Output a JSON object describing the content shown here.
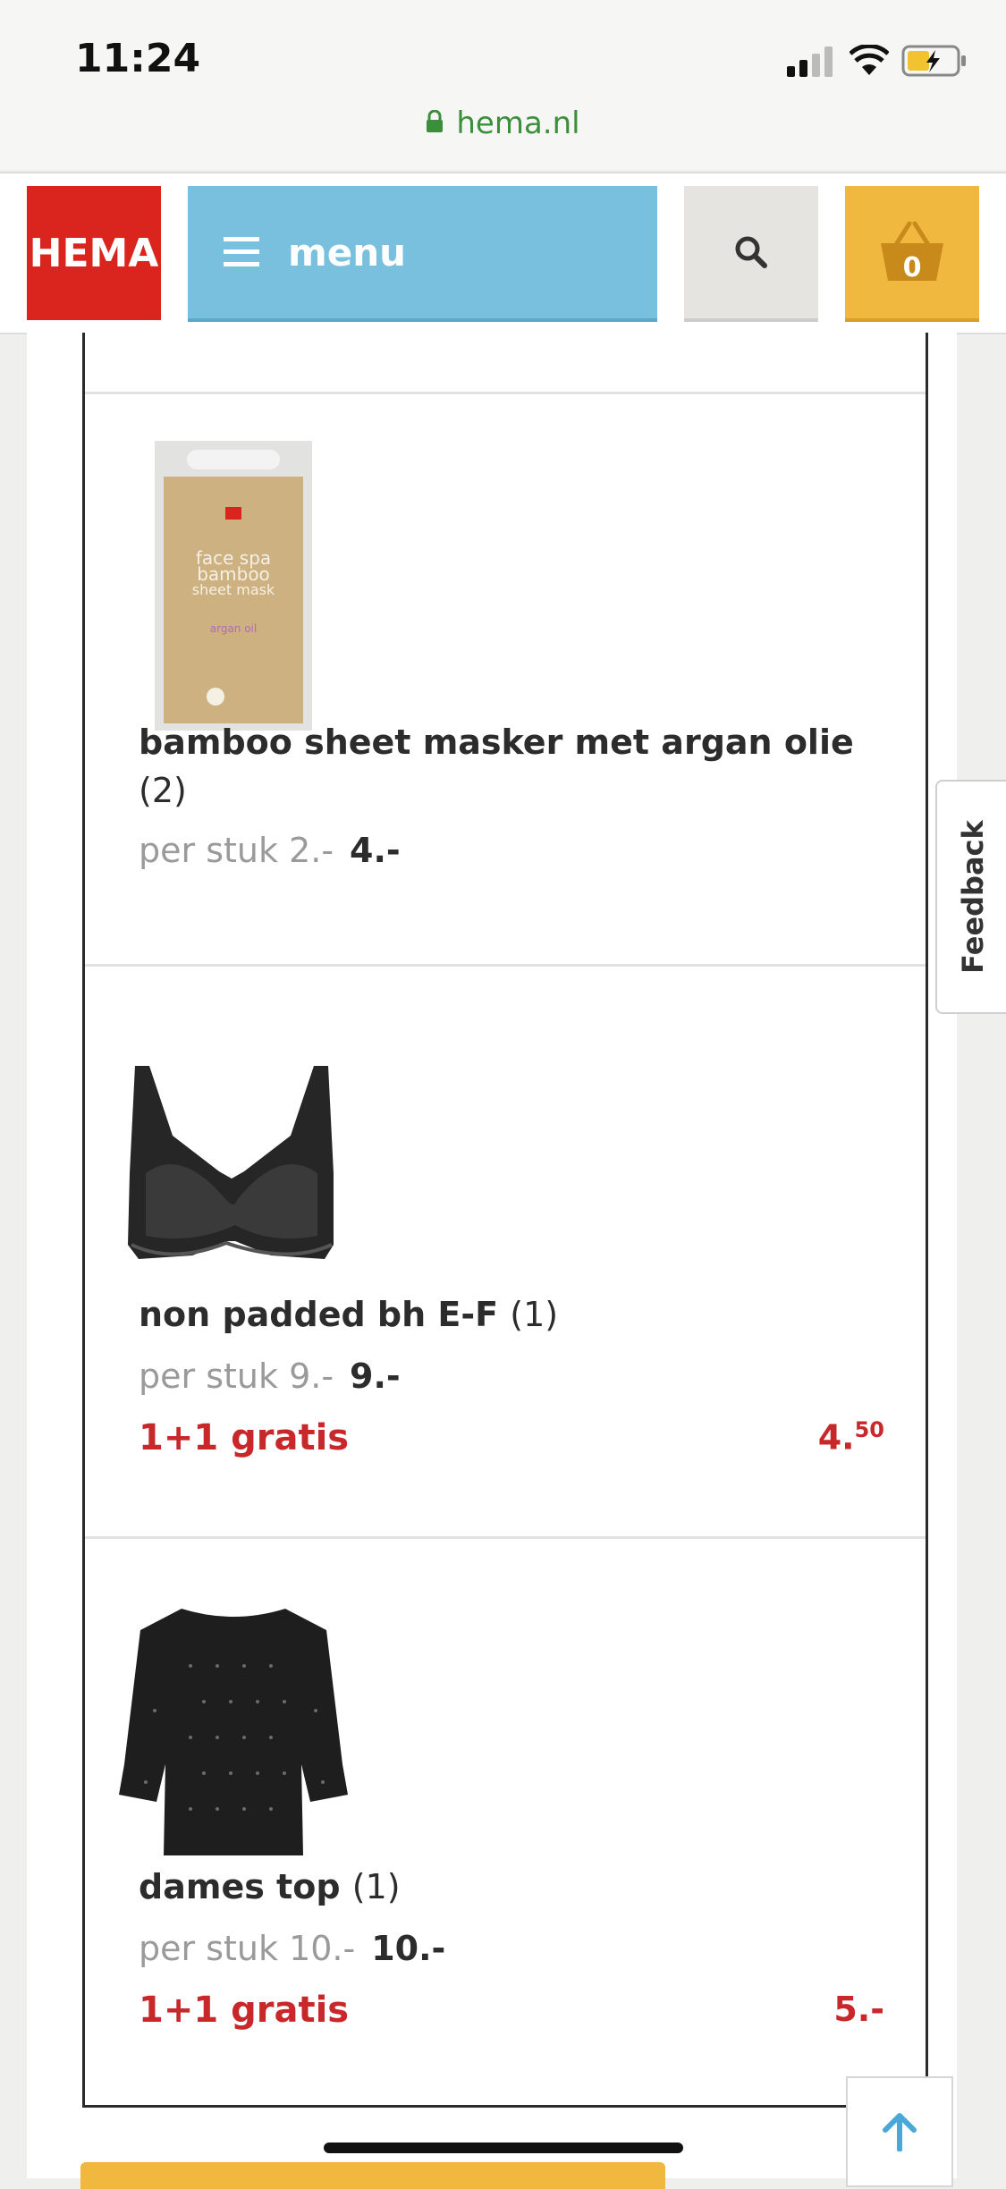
{
  "status_bar": {
    "time": "11:24",
    "url": "hema.nl"
  },
  "header": {
    "logo": "HEMA",
    "menu_label": "menu",
    "cart_count": "0"
  },
  "cart": {
    "items": [
      {
        "name": "bamboo sheet masker met argan olie",
        "quantity": "(2)",
        "unit_price": "per stuk 2.-",
        "total": "4.-",
        "image_text": [
          "face spa",
          "bamboo",
          "sheet mask",
          "argan oil"
        ]
      },
      {
        "name": "non padded bh E-F",
        "quantity": "(1)",
        "unit_price": "per stuk 9.-",
        "total": "9.-",
        "promo": "1+1 gratis",
        "promo_price_main": "4.",
        "promo_price_cents": "50"
      },
      {
        "name": "dames top",
        "quantity": "(1)",
        "unit_price": "per stuk 10.-",
        "total": "10.-",
        "promo": "1+1 gratis",
        "promo_price": "5.-"
      }
    ]
  },
  "feedback_label": "Feedback",
  "colors": {
    "hema_red": "#d9251d",
    "menu_blue": "#79c0df",
    "cart_yellow": "#f0b83e",
    "promo_red": "#c8282a"
  },
  "icons": [
    "lock-icon",
    "hamburger-icon",
    "search-icon",
    "basket-icon",
    "arrow-up-icon"
  ]
}
